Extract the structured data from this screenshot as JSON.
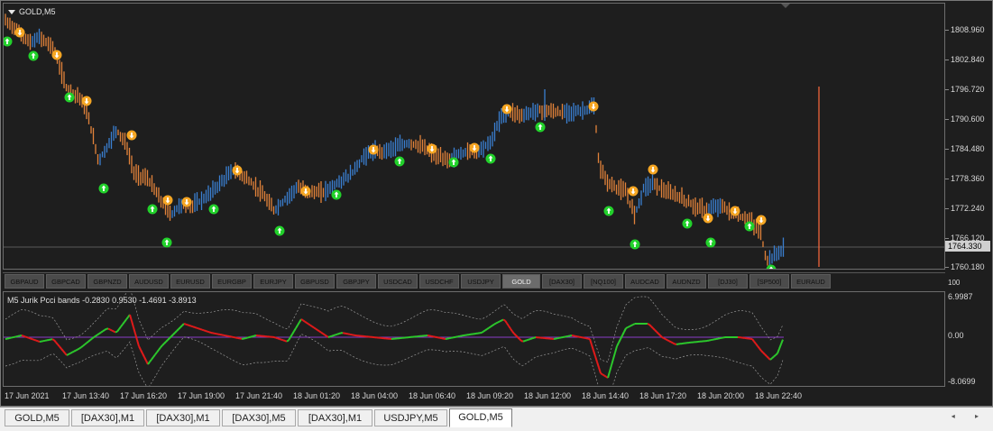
{
  "chart": {
    "symbol_title": "GOLD,M5",
    "price_axis": [
      "1808.960",
      "1802.840",
      "1796.720",
      "1790.600",
      "1784.480",
      "1778.360",
      "1772.240",
      "1766.120",
      "1760.180"
    ],
    "current_price": "1764.330",
    "sub_axis_top_small": "100",
    "sub_axis": [
      "6.9987",
      "0.00",
      "-8.0699"
    ],
    "indicator": {
      "timeframe": "M5",
      "name": "Jurik Pcci bands",
      "values": "-0.2830 0.9530 -1.4691 -3.8913"
    },
    "time_axis": [
      "17 Jun 2021",
      "17 Jun 13:40",
      "17 Jun 16:20",
      "17 Jun 19:00",
      "17 Jun 21:40",
      "18 Jun 01:20",
      "18 Jun 04:00",
      "18 Jun 06:40",
      "18 Jun 09:20",
      "18 Jun 12:00",
      "18 Jun 14:40",
      "18 Jun 17:20",
      "18 Jun 20:00",
      "18 Jun 22:40"
    ],
    "colors": {
      "background": "#1e1e1e",
      "bull": "#3a7fd1",
      "bear": "#e2823a",
      "up_arrow": "#22d12b",
      "down_arrow": "#f5a623",
      "cci_up": "#2cc82c",
      "cci_down": "#e01a1a",
      "zero_line": "#8a3cc8"
    }
  },
  "symbols": [
    "GBPAUD",
    "GBPCAD",
    "GBPNZD",
    "AUDUSD",
    "EURUSD",
    "EURGBP",
    "EURJPY",
    "GBPUSD",
    "GBPJPY",
    "USDCAD",
    "USDCHF",
    "USDJPY",
    "GOLD",
    "[DAX30]",
    "[NQ100]",
    "AUDCAD",
    "AUDNZD",
    "[DJ30]",
    "[SP500]",
    "EURAUD"
  ],
  "active_symbol": "GOLD",
  "tabs": [
    "GOLD,M5",
    "[DAX30],M1",
    "[DAX30],M1",
    "[DAX30],M5",
    "[DAX30],M1",
    "USDJPY,M5",
    "GOLD,M5"
  ],
  "active_tab_index": 6,
  "scroll_arrows": "◂ ▸"
}
